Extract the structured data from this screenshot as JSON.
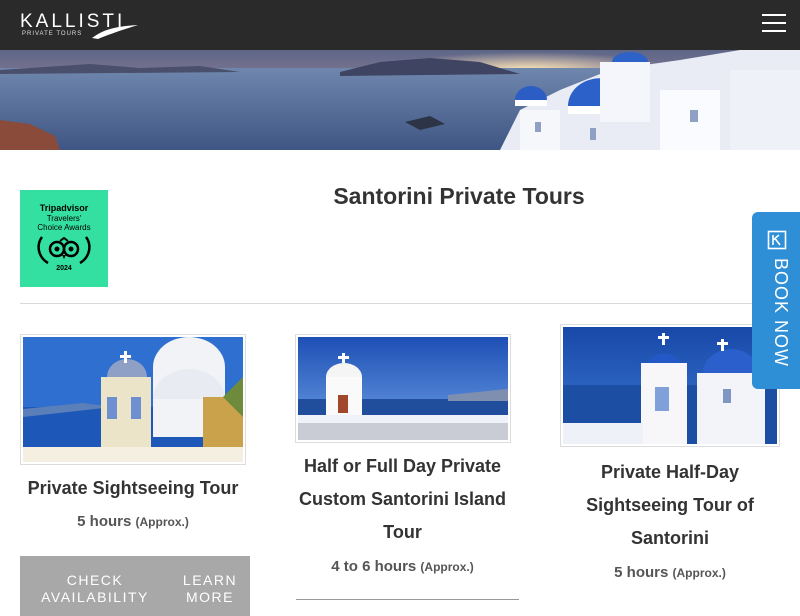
{
  "header": {
    "logo_text": "KALLISTI",
    "logo_subtext": "PRIVATE TOURS",
    "menu_icon": "hamburger-menu-icon"
  },
  "banner": {
    "image": "santorini-caldera-sunset"
  },
  "award": {
    "line1": "Tripadvisor",
    "line2": "Travelers'",
    "line3": "Choice Awards",
    "year": "2024"
  },
  "page": {
    "title": "Santorini Private Tours"
  },
  "tours": [
    {
      "title": "Private Sightseeing Tour",
      "duration": "5 hours",
      "approx": "(Approx.)",
      "buttons": [
        "CHECK AVAILABILITY",
        "LEARN MORE"
      ]
    },
    {
      "title_lines": [
        "Half or Full Day Private",
        "Custom Santorini Island",
        "Tour"
      ],
      "duration": "4 to 6 hours",
      "approx": "(Approx.)"
    },
    {
      "title_lines": [
        "Private Half-Day",
        "Sightseeing Tour of",
        "Santorini"
      ],
      "duration": "5 hours",
      "approx": "(Approx.)"
    }
  ],
  "book_now": {
    "label": "BOOK NOW",
    "icon": "booking-icon"
  },
  "colors": {
    "header_bg": "#2a2a2a",
    "award_green": "#34e0a1",
    "book_now_blue": "#2f8fd6",
    "button_gray": "#a8a8a8"
  }
}
